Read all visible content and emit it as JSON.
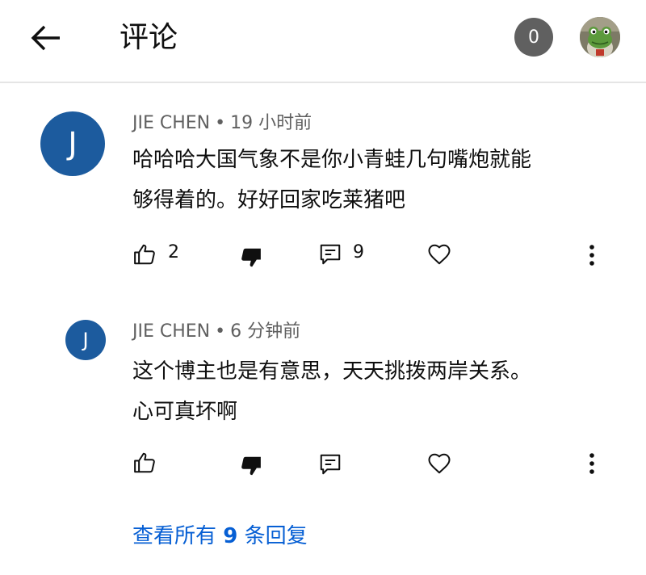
{
  "header": {
    "title": "评论",
    "notification_count": "0",
    "back_icon": "arrow-left-icon",
    "profile_icon": "frog-avatar"
  },
  "comments": [
    {
      "avatar_letter": "J",
      "author": "JIE CHEN",
      "separator": "•",
      "time": "19 小时前",
      "lines": [
        "哈哈哈大国气象不是你小青蛙几句嘴炮就能",
        "够得着的。好好回家吃莱猪吧"
      ],
      "likes": "2",
      "replies": "9"
    },
    {
      "avatar_letter": "J",
      "author": "JIE CHEN",
      "separator": "•",
      "time": "6 分钟前",
      "lines": [
        "这个博主也是有意思，天天挑拨两岸关系。",
        "心可真坏啊"
      ],
      "likes": "",
      "replies": ""
    }
  ],
  "view_replies": {
    "prefix": "查看所有",
    "count": "9",
    "suffix": "条回复"
  },
  "colors": {
    "avatar_bg": "#1c5b9e",
    "link": "#065fd4",
    "meta": "#606060",
    "badge": "#606060"
  }
}
